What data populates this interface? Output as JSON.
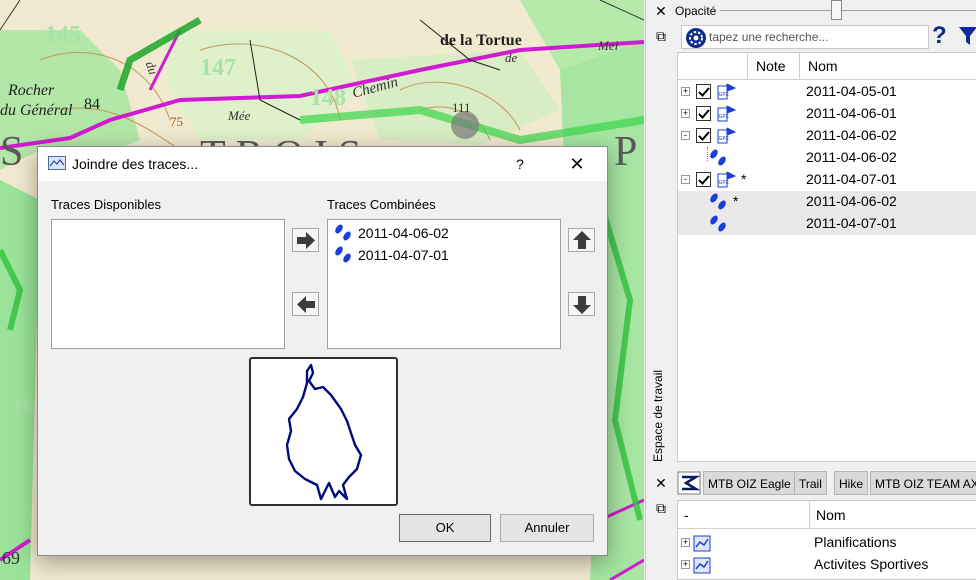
{
  "map": {
    "labels": [
      "145",
      "147",
      "148",
      "Rocher",
      "du Général",
      "84",
      "de la Tortue",
      "Chemin",
      "de",
      "Mée",
      "du",
      "75",
      "TROIS",
      "S",
      "P",
      "Mel",
      "16",
      "69",
      "111"
    ]
  },
  "dialog": {
    "title": "Joindre des traces...",
    "help_label": "?",
    "close_label": "✕",
    "available_label": "Traces Disponibles",
    "available_items": [],
    "combined_label": "Traces Combinées",
    "combined_items": [
      "2011-04-06-02",
      "2011-04-07-01"
    ],
    "ok_label": "OK",
    "cancel_label": "Annuler"
  },
  "right_panel": {
    "close_label": "✕",
    "float_label": "⧉",
    "opacity_label": "Opacité",
    "opacity_value": 0.45,
    "search_placeholder": "tapez une recherche...",
    "help_label": "?",
    "columns": {
      "note": "Note",
      "name": "Nom"
    },
    "tree": [
      {
        "name": "2011-04-05-01",
        "type": "gpx",
        "checked": true,
        "expander": "+",
        "star": ""
      },
      {
        "name": "2011-04-06-01",
        "type": "gpx",
        "checked": true,
        "expander": "+",
        "star": ""
      },
      {
        "name": "2011-04-06-02",
        "type": "gpx",
        "checked": true,
        "expander": "-",
        "star": ""
      },
      {
        "name": "2011-04-06-02",
        "type": "track",
        "checked": false,
        "expander": "",
        "star": ""
      },
      {
        "name": "2011-04-07-01",
        "type": "gpx",
        "checked": true,
        "expander": "-",
        "star": "*"
      },
      {
        "name": "2011-04-06-02",
        "type": "track",
        "checked": false,
        "expander": "",
        "star": "*"
      },
      {
        "name": "2011-04-07-01",
        "type": "track",
        "checked": false,
        "expander": "",
        "star": ""
      }
    ],
    "workspace_label": "Espace de travail",
    "tabs": [
      "MTB OIZ Eagle",
      "Trail",
      "Hike",
      "MTB OIZ TEAM AX"
    ],
    "bottom_columns": {
      "first": "-",
      "name": "Nom"
    },
    "bottom_items": [
      "Planifications",
      "Activites Sportives"
    ],
    "colors": {
      "accent": "#1a3ed8",
      "trace": "#000a7a",
      "filter": "#1428a0"
    }
  }
}
